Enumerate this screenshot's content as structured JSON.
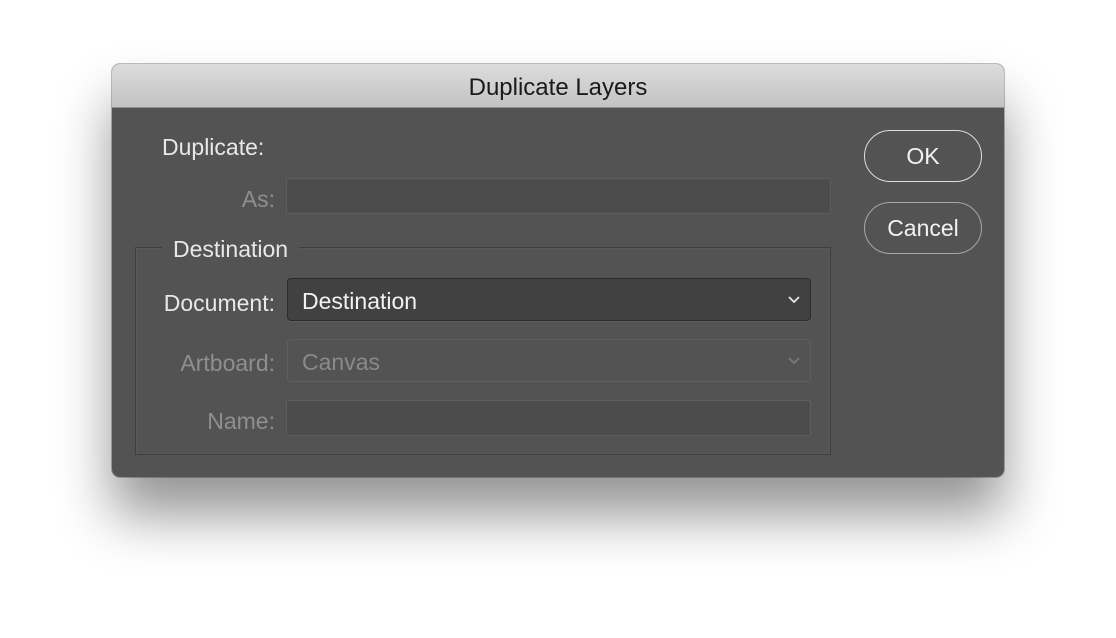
{
  "dialog": {
    "title": "Duplicate Layers"
  },
  "duplicate": {
    "label": "Duplicate:",
    "as_label": "As:",
    "as_value": ""
  },
  "destination": {
    "legend": "Destination",
    "document_label": "Document:",
    "document_value": "Destination",
    "artboard_label": "Artboard:",
    "artboard_value": "Canvas",
    "name_label": "Name:",
    "name_value": ""
  },
  "buttons": {
    "ok_label": "OK",
    "cancel_label": "Cancel"
  },
  "icons": {
    "dropdown": "chevron-down-icon"
  },
  "colors": {
    "dialog_bg": "#535353",
    "titlebar_bg": "#c8c8c8",
    "text": "#e8e8e8",
    "text_disabled": "#8f8f8f"
  }
}
